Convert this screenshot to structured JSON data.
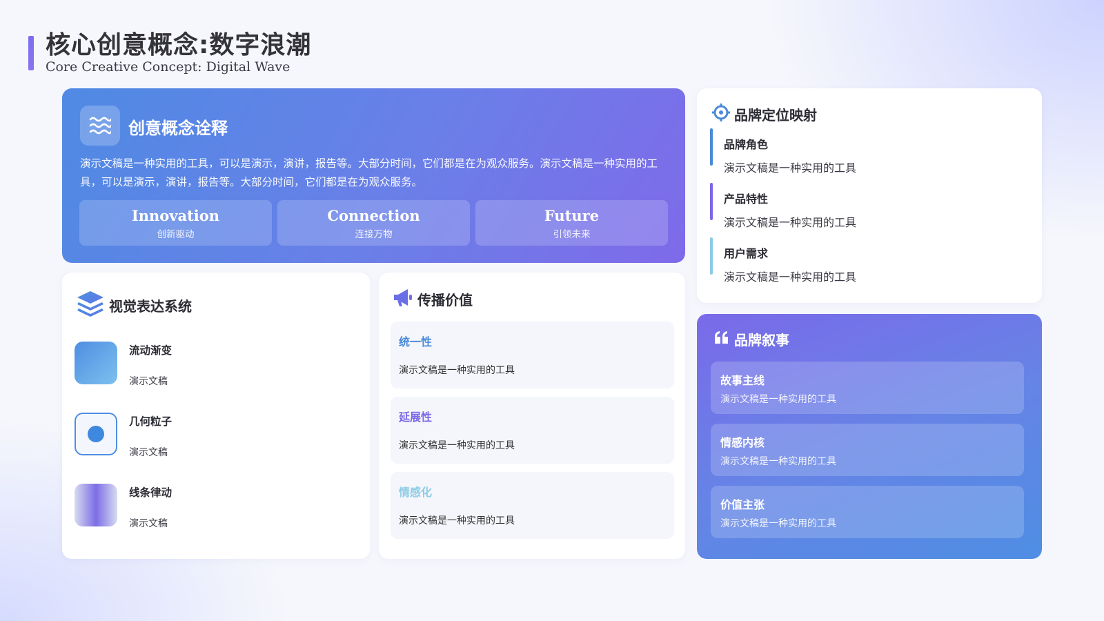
{
  "header": {
    "title": "核心创意概念:数字浪潮",
    "subtitle": "Core Creative Concept: Digital Wave"
  },
  "concept": {
    "title": "创意概念诠释",
    "icon": "waves-icon",
    "description": "演示文稿是一种实用的工具，可以是演示，演讲，报告等。大部分时间，它们都是在为观众服务。演示文稿是一种实用的工具，可以是演示，演讲，报告等。大部分时间，它们都是在为观众服务。",
    "pillars": [
      {
        "en": "Innovation",
        "cn": "创新驱动"
      },
      {
        "en": "Connection",
        "cn": "连接万物"
      },
      {
        "en": "Future",
        "cn": "引领未来"
      }
    ]
  },
  "visual_system": {
    "title": "视觉表达系统",
    "icon": "layers-icon",
    "items": [
      {
        "name": "流动渐变",
        "desc": "演示文稿"
      },
      {
        "name": "几何粒子",
        "desc": "演示文稿"
      },
      {
        "name": "线条律动",
        "desc": "演示文稿"
      }
    ]
  },
  "communication": {
    "title": "传播价值",
    "icon": "megaphone-icon",
    "items": [
      {
        "title": "统一性",
        "desc": "演示文稿是一种实用的工具",
        "color": "#4a8ad8"
      },
      {
        "title": "延展性",
        "desc": "演示文稿是一种实用的工具",
        "color": "#7b68e6"
      },
      {
        "title": "情感化",
        "desc": "演示文稿是一种实用的工具",
        "color": "#8ccbe6"
      }
    ]
  },
  "positioning": {
    "title": "品牌定位映射",
    "icon": "crosshair-icon",
    "items": [
      {
        "title": "品牌角色",
        "desc": "演示文稿是一种实用的工具",
        "color": "#4a8ad8"
      },
      {
        "title": "产品特性",
        "desc": "演示文稿是一种实用的工具",
        "color": "#7b68e6"
      },
      {
        "title": "用户需求",
        "desc": "演示文稿是一种实用的工具",
        "color": "#8ccbe6"
      }
    ]
  },
  "narrative": {
    "title": "品牌叙事",
    "icon": "quote-icon",
    "items": [
      {
        "title": "故事主线",
        "desc": "演示文稿是一种实用的工具"
      },
      {
        "title": "情感内核",
        "desc": "演示文稿是一种实用的工具"
      },
      {
        "title": "价值主张",
        "desc": "演示文稿是一种实用的工具"
      }
    ]
  },
  "colors": {
    "primary_blue": "#4f8ae4",
    "primary_purple": "#7b68e6",
    "light_cyan": "#8ccbe6"
  }
}
